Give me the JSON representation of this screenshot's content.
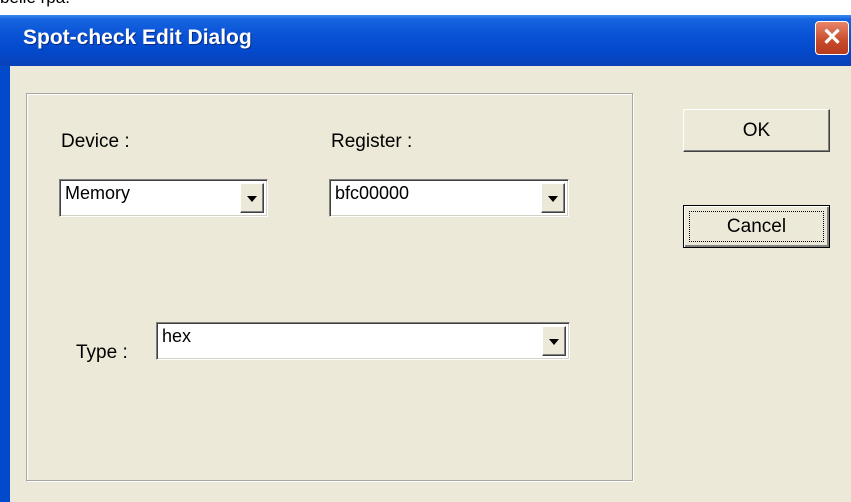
{
  "page_top_text": "belle rpa.",
  "dialog": {
    "title": "Spot-check Edit Dialog",
    "close_symbol": "✕"
  },
  "form": {
    "device": {
      "label": "Device :",
      "value": "Memory"
    },
    "register": {
      "label": "Register :",
      "value": "bfc00000"
    },
    "type": {
      "label": "Type :",
      "value": "hex"
    }
  },
  "buttons": {
    "ok_label": "OK",
    "cancel_label": "Cancel"
  },
  "icons": {
    "close": "close-icon",
    "dropdown": "chevron-down-icon"
  },
  "colors": {
    "titlebar": "#0a52d6",
    "dialog_bg": "#ece9d8",
    "close_button": "#c64a2a"
  }
}
